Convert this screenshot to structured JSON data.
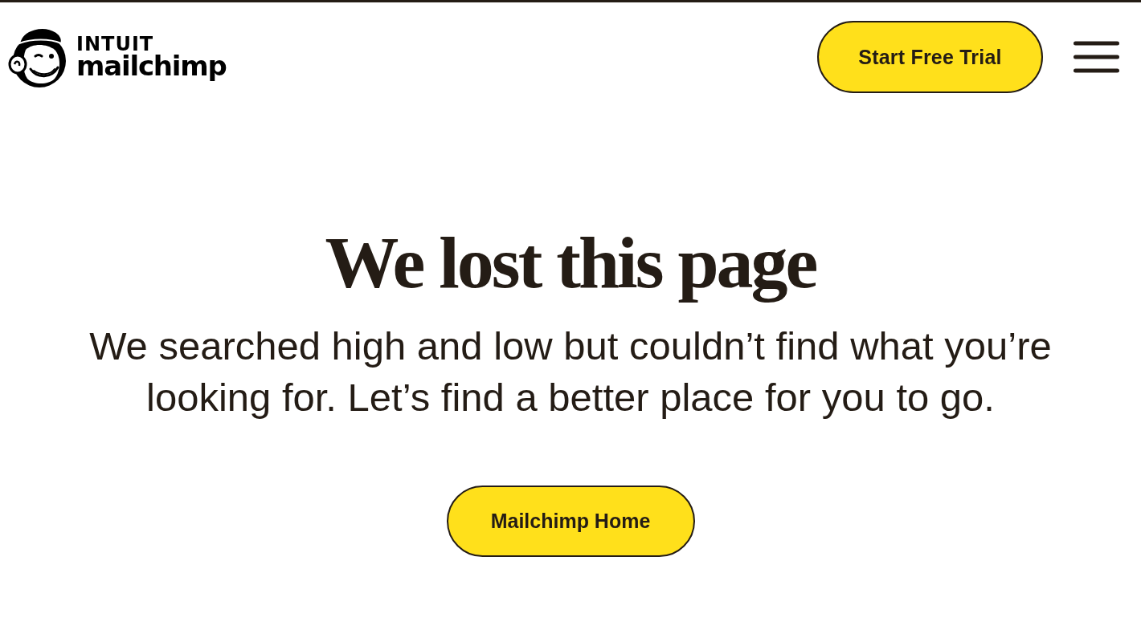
{
  "header": {
    "logo": {
      "brand": "INTUIT",
      "name": "mailchimp"
    },
    "cta_button": "Start Free Trial",
    "menu": {
      "expanded": false
    }
  },
  "main": {
    "heading": "We lost this page",
    "message": "We searched high and low but couldn’t find what you’re looking for. Let’s find a better place for you to go.",
    "home_button": "Mailchimp Home"
  }
}
